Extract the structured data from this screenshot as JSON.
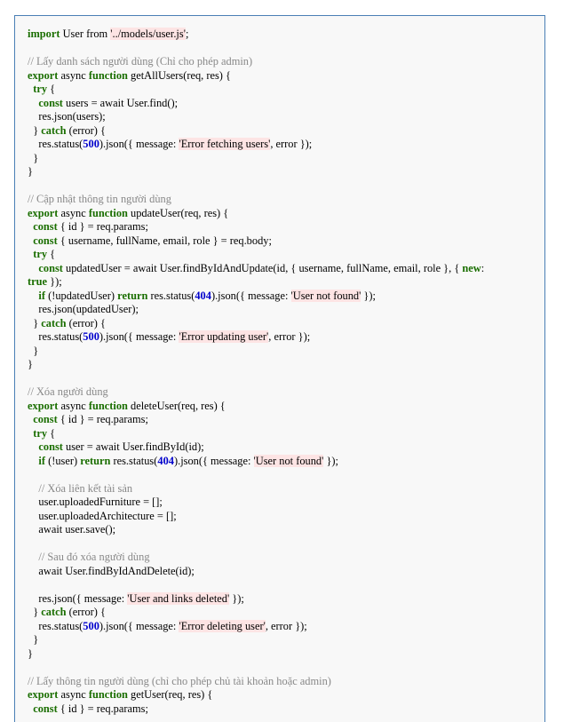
{
  "code_lines": [
    [
      [
        "kw",
        "import"
      ],
      [
        "pl",
        " User from "
      ],
      [
        "str",
        "'../models/user.js'"
      ],
      [
        "pl",
        ";"
      ]
    ],
    [],
    [
      [
        "cm",
        "// Lấy danh sách người dùng (Chỉ cho phép admin)"
      ]
    ],
    [
      [
        "kw",
        "export"
      ],
      [
        "pl",
        " async "
      ],
      [
        "kw",
        "function"
      ],
      [
        "pl",
        " getAllUsers(req, res) {"
      ]
    ],
    [
      [
        "pl",
        "  "
      ],
      [
        "kw",
        "try"
      ],
      [
        "pl",
        " {"
      ]
    ],
    [
      [
        "pl",
        "    "
      ],
      [
        "kw",
        "const"
      ],
      [
        "pl",
        " users = await User.find();"
      ]
    ],
    [
      [
        "pl",
        "    res.json(users);"
      ]
    ],
    [
      [
        "pl",
        "  } "
      ],
      [
        "kw",
        "catch"
      ],
      [
        "pl",
        " (error) {"
      ]
    ],
    [
      [
        "pl",
        "    res.status("
      ],
      [
        "num",
        "500"
      ],
      [
        "pl",
        ").json({ message: "
      ],
      [
        "str",
        "'Error fetching users'"
      ],
      [
        "pl",
        ", error });"
      ]
    ],
    [
      [
        "pl",
        "  }"
      ]
    ],
    [
      [
        "pl",
        "}"
      ]
    ],
    [],
    [
      [
        "cm",
        "// Cập nhật thông tin người dùng"
      ]
    ],
    [
      [
        "kw",
        "export"
      ],
      [
        "pl",
        " async "
      ],
      [
        "kw",
        "function"
      ],
      [
        "pl",
        " updateUser(req, res) {"
      ]
    ],
    [
      [
        "pl",
        "  "
      ],
      [
        "kw",
        "const"
      ],
      [
        "pl",
        " { id } = req.params;"
      ]
    ],
    [
      [
        "pl",
        "  "
      ],
      [
        "kw",
        "const"
      ],
      [
        "pl",
        " { username, fullName, email, role } = req.body;"
      ]
    ],
    [
      [
        "pl",
        "  "
      ],
      [
        "kw",
        "try"
      ],
      [
        "pl",
        " {"
      ]
    ],
    [
      [
        "pl",
        "    "
      ],
      [
        "kw",
        "const"
      ],
      [
        "pl",
        " updatedUser = await User.findByIdAndUpdate(id, { username, fullName, email, role }, { "
      ],
      [
        "kw",
        "new"
      ],
      [
        "pl",
        ":"
      ]
    ],
    [
      [
        "kw",
        "true"
      ],
      [
        "pl",
        " });"
      ]
    ],
    [
      [
        "pl",
        "    "
      ],
      [
        "kw",
        "if"
      ],
      [
        "pl",
        " (!updatedUser) "
      ],
      [
        "kw",
        "return"
      ],
      [
        "pl",
        " res.status("
      ],
      [
        "num",
        "404"
      ],
      [
        "pl",
        ").json({ message: "
      ],
      [
        "str",
        "'User not found'"
      ],
      [
        "pl",
        " });"
      ]
    ],
    [
      [
        "pl",
        "    res.json(updatedUser);"
      ]
    ],
    [
      [
        "pl",
        "  } "
      ],
      [
        "kw",
        "catch"
      ],
      [
        "pl",
        " (error) {"
      ]
    ],
    [
      [
        "pl",
        "    res.status("
      ],
      [
        "num",
        "500"
      ],
      [
        "pl",
        ").json({ message: "
      ],
      [
        "str",
        "'Error updating user'"
      ],
      [
        "pl",
        ", error });"
      ]
    ],
    [
      [
        "pl",
        "  }"
      ]
    ],
    [
      [
        "pl",
        "}"
      ]
    ],
    [],
    [
      [
        "cm",
        "// Xóa người dùng"
      ]
    ],
    [
      [
        "kw",
        "export"
      ],
      [
        "pl",
        " async "
      ],
      [
        "kw",
        "function"
      ],
      [
        "pl",
        " deleteUser(req, res) {"
      ]
    ],
    [
      [
        "pl",
        "  "
      ],
      [
        "kw",
        "const"
      ],
      [
        "pl",
        " { id } = req.params;"
      ]
    ],
    [
      [
        "pl",
        "  "
      ],
      [
        "kw",
        "try"
      ],
      [
        "pl",
        " {"
      ]
    ],
    [
      [
        "pl",
        "    "
      ],
      [
        "kw",
        "const"
      ],
      [
        "pl",
        " user = await User.findById(id);"
      ]
    ],
    [
      [
        "pl",
        "    "
      ],
      [
        "kw",
        "if"
      ],
      [
        "pl",
        " (!user) "
      ],
      [
        "kw",
        "return"
      ],
      [
        "pl",
        " res.status("
      ],
      [
        "num",
        "404"
      ],
      [
        "pl",
        ").json({ message: "
      ],
      [
        "str",
        "'User not found'"
      ],
      [
        "pl",
        " });"
      ]
    ],
    [],
    [
      [
        "pl",
        "    "
      ],
      [
        "cm",
        "// Xóa liên kết tài sản"
      ]
    ],
    [
      [
        "pl",
        "    user.uploadedFurniture = [];"
      ]
    ],
    [
      [
        "pl",
        "    user.uploadedArchitecture = [];"
      ]
    ],
    [
      [
        "pl",
        "    await user.save();"
      ]
    ],
    [],
    [
      [
        "pl",
        "    "
      ],
      [
        "cm",
        "// Sau đó xóa người dùng"
      ]
    ],
    [
      [
        "pl",
        "    await User.findByIdAndDelete(id);"
      ]
    ],
    [],
    [
      [
        "pl",
        "    res.json({ message: "
      ],
      [
        "str",
        "'User and links deleted'"
      ],
      [
        "pl",
        " });"
      ]
    ],
    [
      [
        "pl",
        "  } "
      ],
      [
        "kw",
        "catch"
      ],
      [
        "pl",
        " (error) {"
      ]
    ],
    [
      [
        "pl",
        "    res.status("
      ],
      [
        "num",
        "500"
      ],
      [
        "pl",
        ").json({ message: "
      ],
      [
        "str",
        "'Error deleting user'"
      ],
      [
        "pl",
        ", error });"
      ]
    ],
    [
      [
        "pl",
        "  }"
      ]
    ],
    [
      [
        "pl",
        "}"
      ]
    ],
    [],
    [
      [
        "cm",
        "// Lấy thông tin người dùng (chỉ cho phép chủ tài khoản hoặc admin)"
      ]
    ],
    [
      [
        "kw",
        "export"
      ],
      [
        "pl",
        " async "
      ],
      [
        "kw",
        "function"
      ],
      [
        "pl",
        " getUser(req, res) {"
      ]
    ],
    [
      [
        "pl",
        "  "
      ],
      [
        "kw",
        "const"
      ],
      [
        "pl",
        " { id } = req.params;"
      ]
    ]
  ]
}
